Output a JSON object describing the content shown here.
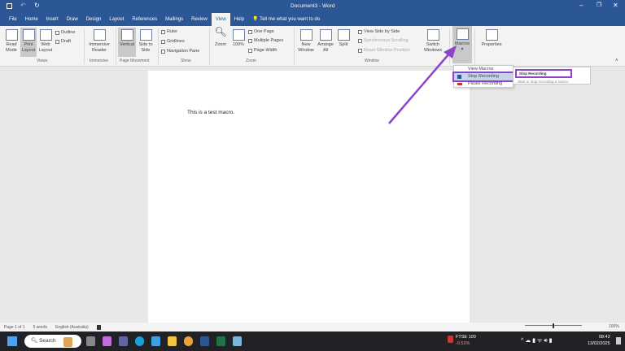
{
  "title": "Document3 - Word",
  "tabs": [
    "File",
    "Home",
    "Insert",
    "Draw",
    "Design",
    "Layout",
    "References",
    "Mailings",
    "Review",
    "View",
    "Help"
  ],
  "active_tab": "View",
  "tell_me": "Tell me what you want to do",
  "ribbon": {
    "views": {
      "read_mode": "Read Mode",
      "print_layout": "Print Layout",
      "web_layout": "Web Layout",
      "outline": "Outline",
      "draft": "Draft",
      "label": "Views"
    },
    "immersive": {
      "reader": "Immersive Reader",
      "label": "Immersive"
    },
    "page_movement": {
      "vertical": "Vertical",
      "side": "Side to Side",
      "label": "Page Movement"
    },
    "show": {
      "ruler": "Ruler",
      "gridlines": "Gridlines",
      "nav": "Navigation Pane",
      "label": "Show"
    },
    "zoom": {
      "zoom": "Zoom",
      "pct": "100%",
      "one_page": "One Page",
      "multiple": "Multiple Pages",
      "width": "Page Width",
      "label": "Zoom"
    },
    "window": {
      "new": "New Window",
      "arrange": "Arrange All",
      "split": "Split",
      "side_by_side": "View Side by Side",
      "sync": "Synchronous Scrolling",
      "reset": "Reset Window Position",
      "switch": "Switch Windows",
      "label": "Window"
    },
    "macros": "Macros",
    "properties": "Properties"
  },
  "menu": {
    "view_macros": "View Macros",
    "stop_recording": "Stop Recording",
    "pause_recording": "Pause Recording"
  },
  "tooltip": {
    "title": "Stop Recording",
    "desc": "Start or stop recording a macro."
  },
  "document_text": "This is a test macro.",
  "status": {
    "page": "Page 1 of 1",
    "words": "5 words",
    "language": "English (Australia)",
    "zoom": "100%"
  },
  "taskbar": {
    "search": "Search",
    "stock_name": "FTSE 100",
    "stock_change": "-0.52%",
    "time": "08:42",
    "date": "13/02/2025"
  },
  "colors": {
    "word_blue": "#2b5797",
    "highlight": "#8e44c8"
  }
}
